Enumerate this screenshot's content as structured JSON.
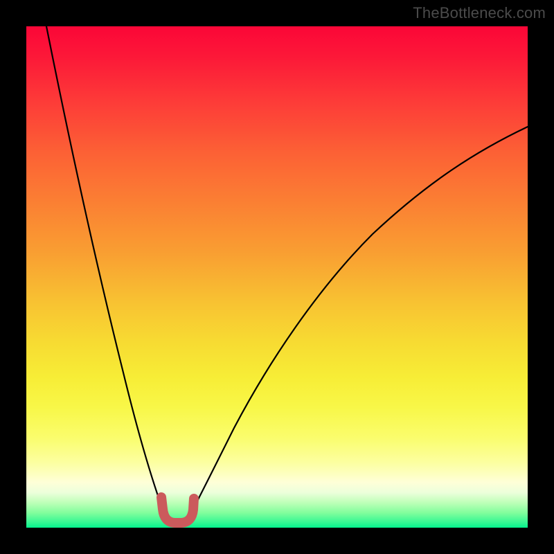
{
  "watermark": "TheBottleneck.com",
  "colors": {
    "frame": "#000000",
    "curve": "#000000",
    "marker": "#cb5a5c",
    "gradient_top": "#fb0637",
    "gradient_bottom": "#03f28d"
  },
  "chart_data": {
    "type": "line",
    "title": "",
    "xlabel": "",
    "ylabel": "",
    "xlim": [
      0,
      100
    ],
    "ylim": [
      0,
      100
    ],
    "grid": false,
    "legend": false,
    "series": [
      {
        "name": "left-branch",
        "x": [
          4,
          6,
          8,
          10,
          12,
          14,
          16,
          18,
          20,
          22,
          24,
          25.5,
          27,
          28
        ],
        "y": [
          100,
          90,
          80,
          70,
          60,
          50,
          41,
          33,
          25,
          17,
          10,
          5,
          1.5,
          0.5
        ]
      },
      {
        "name": "right-branch",
        "x": [
          32,
          34,
          37,
          40,
          44,
          48,
          52,
          57,
          62,
          68,
          74,
          80,
          86,
          92,
          98,
          100
        ],
        "y": [
          0.5,
          2,
          5,
          10,
          17,
          24,
          31,
          38,
          45,
          52,
          58,
          64,
          69,
          74,
          78,
          80
        ]
      }
    ],
    "marker": {
      "name": "u-shaped-minimum-marker",
      "shape": "U",
      "x_range": [
        26,
        33
      ],
      "y_range": [
        0.5,
        6
      ],
      "color": "#cb5a5c"
    },
    "note": "Axes carry no ticks or numeric labels; x/y values are estimated on a 0–100 normalized scale from the plot geometry."
  }
}
